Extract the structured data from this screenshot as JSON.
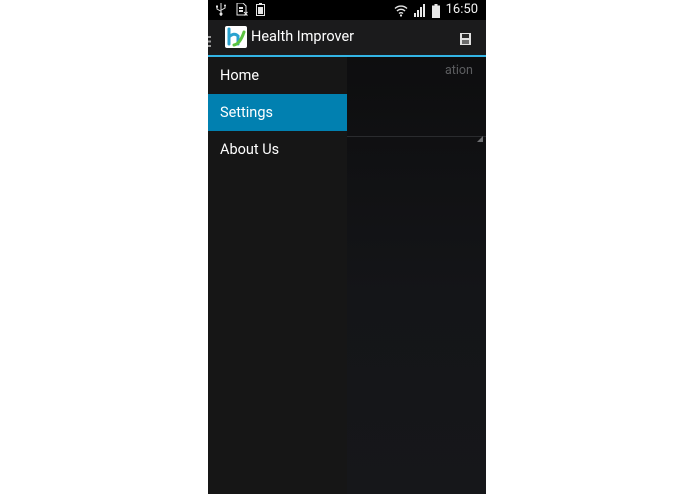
{
  "status_bar": {
    "time": "16:50",
    "left_icons": [
      "usb-icon",
      "sim-card-icon",
      "battery-saver-icon"
    ],
    "right_icons": [
      "wifi-icon",
      "signal-icon",
      "battery-icon"
    ]
  },
  "action_bar": {
    "title": "Health Improver",
    "logo_icon": "health-improver-logo-icon",
    "action_icon": "save-icon"
  },
  "content": {
    "hint_text": "ation"
  },
  "drawer": {
    "items": [
      {
        "label": "Home",
        "active": false
      },
      {
        "label": "Settings",
        "active": true
      },
      {
        "label": "About Us",
        "active": false
      }
    ]
  },
  "colors": {
    "accent": "#33b5e5",
    "selected_item": "#0180b0",
    "drawer_bg": "#161616"
  }
}
